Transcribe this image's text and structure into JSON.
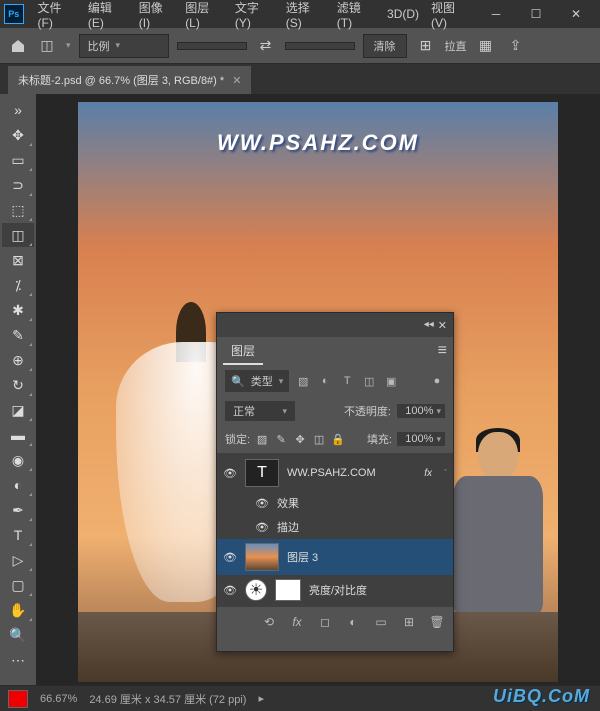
{
  "app": {
    "logo": "Ps"
  },
  "menu": {
    "file": "文件(F)",
    "edit": "编辑(E)",
    "image": "图像(I)",
    "layer": "图层(L)",
    "type": "文字(Y)",
    "select": "选择(S)",
    "filter": "滤镜(T)",
    "threeD": "3D(D)",
    "view": "视图(V)"
  },
  "options": {
    "ratio_label": "比例",
    "clear": "清除",
    "straighten_label": "拉直"
  },
  "tab": {
    "title": "未标题-2.psd @ 66.7% (图层 3, RGB/8#) *"
  },
  "canvas": {
    "watermark_text": "WW.PSAHZ.COM"
  },
  "layers_panel": {
    "title": "图层",
    "filter_label": "类型",
    "blend_mode": "正常",
    "opacity_label": "不透明度:",
    "opacity_value": "100%",
    "lock_label": "锁定:",
    "fill_label": "填充:",
    "fill_value": "100%",
    "layers": [
      {
        "name": "WW.PSAHZ.COM",
        "type": "T",
        "fx": "fx"
      },
      {
        "name": "效果",
        "sub": true
      },
      {
        "name": "描边",
        "sub": true
      },
      {
        "name": "图层 3",
        "type": "img"
      },
      {
        "name": "亮度/对比度",
        "type": "adj"
      }
    ]
  },
  "status": {
    "zoom": "66.67%",
    "dims": "24.69 厘米 x 34.57 厘米 (72 ppi)"
  },
  "footer_watermark": "UiBQ.CoM"
}
